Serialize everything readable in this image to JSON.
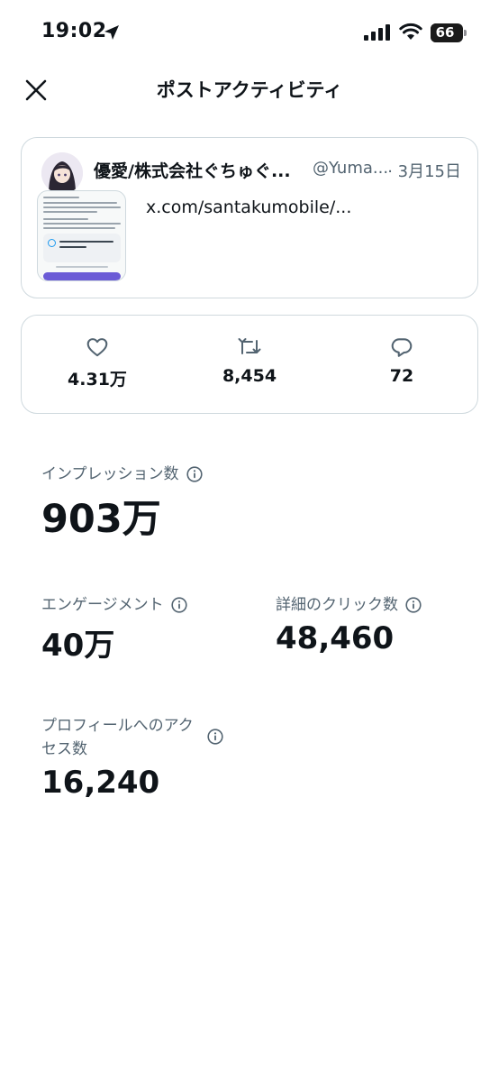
{
  "status_bar": {
    "time": "19:02",
    "battery": "66"
  },
  "header": {
    "title": "ポストアクティビティ"
  },
  "post": {
    "author_name": "優愛/株式会社ぐちゅぐ...",
    "author_handle": "@Yuma...",
    "date": "· 3月15日",
    "link_text": "x.com/santakumobile/..."
  },
  "engagement": {
    "likes": "4.31万",
    "reposts": "8,454",
    "replies": "72"
  },
  "metrics": {
    "impressions": {
      "label": "インプレッション数",
      "value": "903万"
    },
    "engagements": {
      "label": "エンゲージメント",
      "value": "40万"
    },
    "detail_clicks": {
      "label": "詳細のクリック数",
      "value": "48,460"
    },
    "profile_visits": {
      "label_line1": "プロフィールへのアク",
      "label_line2": "セス数",
      "value": "16,240"
    }
  },
  "colors": {
    "text_primary": "#0f1419",
    "text_secondary": "#536471",
    "border": "#cfd9de",
    "accent": "#1d9bf0"
  }
}
